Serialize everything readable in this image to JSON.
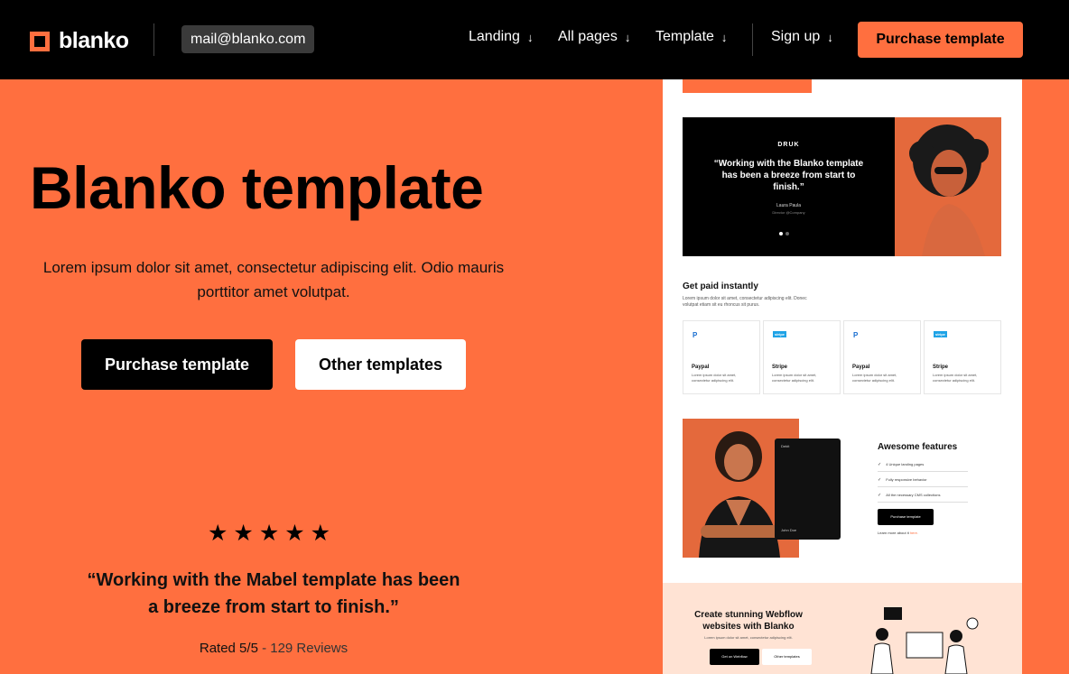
{
  "nav": {
    "logo_text": "blanko",
    "email": "mail@blanko.com",
    "menu": [
      {
        "label": "Landing",
        "arrow": "↓"
      },
      {
        "label": "All pages",
        "arrow": "↓"
      },
      {
        "label": "Template",
        "arrow": "↓"
      },
      {
        "label": "Sign up",
        "arrow": "↓"
      }
    ],
    "cta": "Purchase template"
  },
  "hero": {
    "title": "Blanko template",
    "subtitle": "Lorem ipsum dolor sit amet, consectetur adipiscing elit. Odio mauris porttitor amet volutpat.",
    "primary_button": "Purchase template",
    "secondary_button": "Other templates",
    "stars": "★★★★★",
    "quote": "“Working with the Mabel template has been a breeze from start to finish.”",
    "rated": "Rated 5/5",
    "reviews": " - 129 Reviews"
  },
  "preview": {
    "testimonial": {
      "brand": "DRUK",
      "quote": "“Working with the Blanko template has been a breeze from start to finish.”",
      "name": "Laura Paula",
      "role": "Director @Company"
    },
    "payments": {
      "title": "Get paid instantly",
      "desc": "Lorem ipsum dolor sit amet, consectetur adipiscing elit. Donec volutpat etiam sit eu rhoncus sit purus.",
      "cards": [
        {
          "icon": "P",
          "name": "Paypal",
          "desc": "Lorem ipsum dolor sit amet, consectetur adipiscing elit."
        },
        {
          "icon": "stripe",
          "name": "Stripe",
          "desc": "Lorem ipsum dolor sit amet, consectetur adipiscing elit."
        },
        {
          "icon": "P",
          "name": "Paypal",
          "desc": "Lorem ipsum dolor sit amet, consectetur adipiscing elit."
        },
        {
          "icon": "stripe",
          "name": "Stripe",
          "desc": "Lorem ipsum dolor sit amet, consectetur adipiscing elit."
        }
      ]
    },
    "features": {
      "card_label": "Debit",
      "card_name": "John Doe",
      "title": "Awesome features",
      "items": [
        "4 Unique landing pages",
        "Fully responsive behavior",
        "All the necessary CMS collections"
      ],
      "button": "Purchase template",
      "learn": "Learn more about it ",
      "learn_link": "here."
    },
    "cta": {
      "title": "Create stunning Webflow websites with Blanko",
      "desc": "Lorem ipsum dolor sit amet, consectetur adipiscing elit.",
      "button1": "Get on Webflow",
      "button2": "Other templates"
    }
  },
  "colors": {
    "accent": "#ff6f3f",
    "nav_bg": "#000000"
  }
}
